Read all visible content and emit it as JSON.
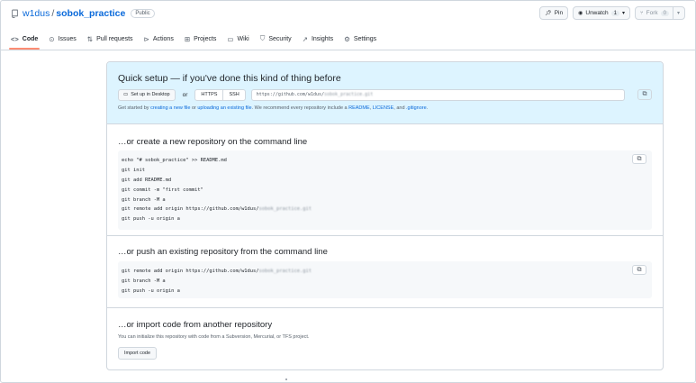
{
  "repo": {
    "owner": "w1dus",
    "separator": "/",
    "name": "sobok_practice",
    "visibility": "Public"
  },
  "header_actions": {
    "pin": "Pin",
    "unwatch": "Unwatch",
    "unwatch_count": "1",
    "fork": "Fork",
    "fork_count": "0"
  },
  "tabs": [
    {
      "label": "Code",
      "icon": "code-icon"
    },
    {
      "label": "Issues",
      "icon": "issue-icon"
    },
    {
      "label": "Pull requests",
      "icon": "pull-request-icon"
    },
    {
      "label": "Actions",
      "icon": "play-icon"
    },
    {
      "label": "Projects",
      "icon": "table-icon"
    },
    {
      "label": "Wiki",
      "icon": "book-icon"
    },
    {
      "label": "Security",
      "icon": "shield-icon"
    },
    {
      "label": "Insights",
      "icon": "graph-icon"
    },
    {
      "label": "Settings",
      "icon": "gear-icon"
    }
  ],
  "quick_setup": {
    "title": "Quick setup — if you've done this kind of thing before",
    "desktop_button": "Set up in Desktop",
    "or": "or",
    "https": "HTTPS",
    "ssh": "SSH",
    "url_prefix": "https://github.com/w1dus/",
    "url_blurred": "sobok_practice.git",
    "hint_start": "Get started by ",
    "hint_link1": "creating a new file",
    "hint_or": " or ",
    "hint_link2": "uploading an existing file",
    "hint_mid": ". We recommend every repository include a ",
    "hint_link3": "README",
    "hint_comma": ", ",
    "hint_link4": "LICENSE",
    "hint_and": ", and ",
    "hint_link5": ".gitignore",
    "hint_end": "."
  },
  "new_repo": {
    "title": "…or create a new repository on the command line",
    "lines": [
      "echo \"# sobok_practice\" >> README.md",
      "git init",
      "git add README.md",
      "git commit -m \"first commit\"",
      "git branch -M a",
      "git remote add origin https://github.com/w1dus/",
      "git push -u origin a"
    ],
    "remote_blurred": "sobok_practice.git"
  },
  "push_existing": {
    "title": "…or push an existing repository from the command line",
    "lines": [
      "git remote add origin https://github.com/w1dus/",
      "git branch -M a",
      "git push -u origin a"
    ],
    "remote_blurred": "sobok_practice.git"
  },
  "import": {
    "title": "…or import code from another repository",
    "description": "You can initialize this repository with code from a Subversion, Mercurial, or TFS project.",
    "button": "Import code"
  }
}
